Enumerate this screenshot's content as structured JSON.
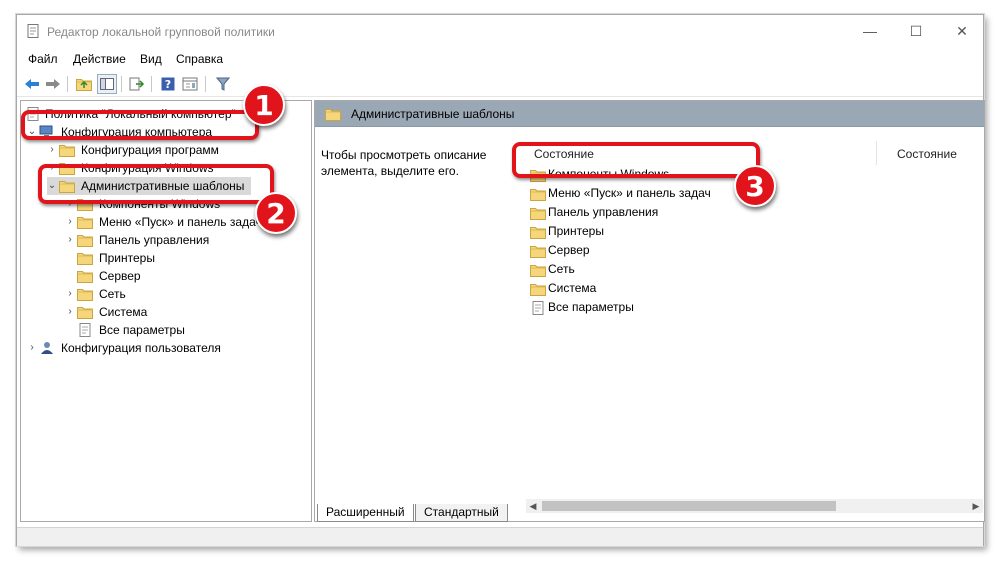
{
  "window": {
    "title": "Редактор локальной групповой политики",
    "controls": {
      "minimize": "—",
      "maximize": "☐",
      "close": "✕"
    }
  },
  "menu": [
    "Файл",
    "Действие",
    "Вид",
    "Справка"
  ],
  "toolbar": {
    "icons": [
      "back-arrow-icon",
      "forward-arrow-icon",
      "up-folder-icon",
      "show-hide-tree-icon",
      "export-list-icon",
      "help-icon",
      "properties-icon",
      "filter-icon"
    ]
  },
  "tree": {
    "root": "Политика \"Локальный компьютер\"",
    "computer_config": "Конфигурация компьютера",
    "program_config": "Конфигурация программ",
    "windows_config": "Конфигурация Windows",
    "admin_templates": "Административные шаблоны",
    "children": [
      "Компоненты Windows",
      "Меню «Пуск» и панель задач",
      "Панель управления",
      "Принтеры",
      "Сервер",
      "Сеть",
      "Система",
      "Все параметры"
    ],
    "user_config": "Конфигурация пользователя"
  },
  "right": {
    "header": "Административные шаблоны",
    "description": "Чтобы просмотреть описание элемента, выделите его.",
    "column1": "Состояние",
    "column2": "Состояние",
    "items": [
      "Компоненты Windows",
      "Меню «Пуск» и панель задач",
      "Панель управления",
      "Принтеры",
      "Сервер",
      "Сеть",
      "Система",
      "Все параметры"
    ]
  },
  "tabs": [
    "Расширенный",
    "Стандартный"
  ],
  "callouts": [
    "1",
    "2",
    "3"
  ],
  "colors": {
    "callout": "#e2141b",
    "header": "#9aa7b5",
    "folder": "#f5d67a"
  }
}
